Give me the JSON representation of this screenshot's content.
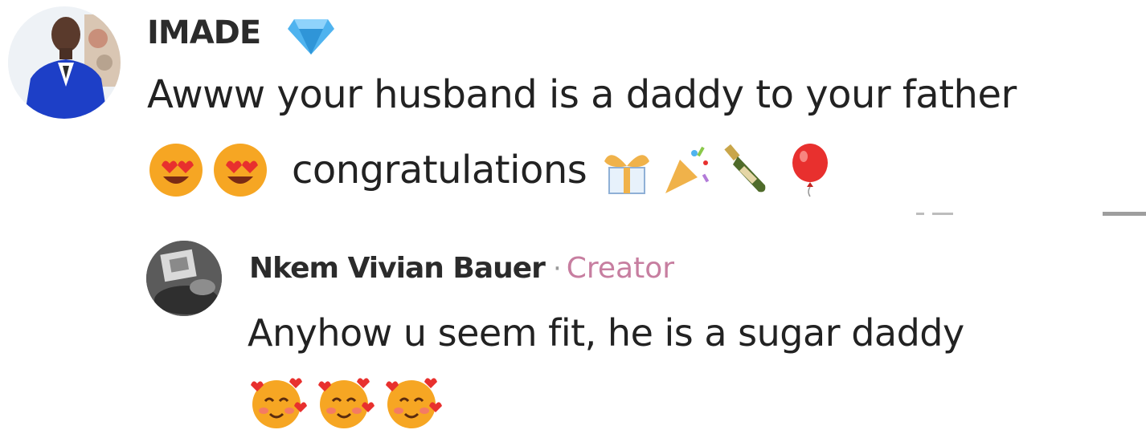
{
  "comment": {
    "username": "IMADE",
    "badge_icon": "diamond-icon",
    "text_line1": "Awww your husband is a daddy to your father",
    "text_line2": "congratulations",
    "emojis_before": [
      "smiling-face-with-heart-eyes",
      "smiling-face-with-heart-eyes"
    ],
    "emojis_after": [
      "gift-icon",
      "party-popper-icon",
      "champagne-icon",
      "balloon-icon"
    ]
  },
  "reply": {
    "username": "Nkem Vivian Bauer",
    "separator": "·",
    "role": "Creator",
    "text": "Anyhow u seem fit, he is a sugar daddy",
    "emojis": [
      "smiling-face-with-hearts",
      "smiling-face-with-hearts",
      "smiling-face-with-hearts"
    ]
  },
  "colors": {
    "text": "#222222",
    "creator": "#c77ea0",
    "diamond": "#4fb3ef"
  }
}
